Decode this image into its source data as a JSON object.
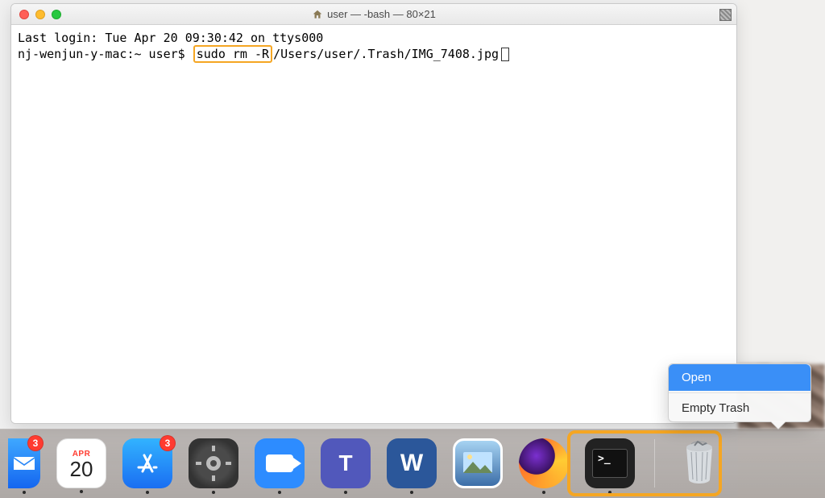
{
  "window": {
    "title": "user — -bash — 80×21"
  },
  "terminal": {
    "line1": "Last login: Tue Apr 20 09:30:42 on ttys000",
    "prompt": "nj-wenjun-y-mac:~ user$ ",
    "highlight": "sudo rm -R",
    "rest": "/Users/user/.Trash/IMG_7408.jpg"
  },
  "dock": {
    "mail_badge": "3",
    "appstore_badge": "3",
    "calendar_month": "APR",
    "calendar_day": "20",
    "terminal_glyph": ">_"
  },
  "menu": {
    "open": "Open",
    "empty": "Empty Trash"
  }
}
